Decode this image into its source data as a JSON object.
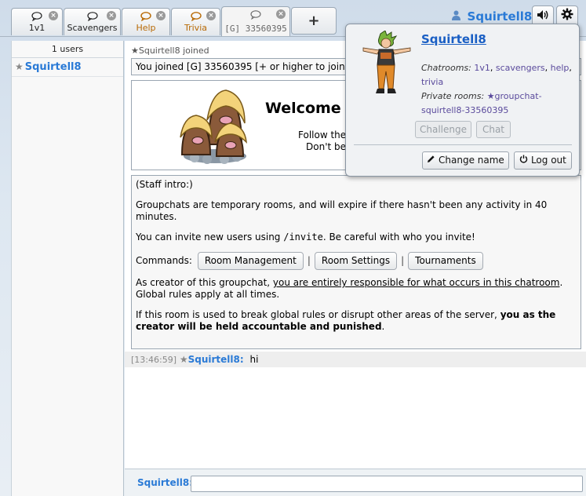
{
  "tabs": [
    {
      "label": "1v1",
      "icon": "chat-bubble-icon"
    },
    {
      "label": "Scavengers",
      "icon": "chat-bubble-icon"
    },
    {
      "label": "Help",
      "icon": "chat-bubble-icon",
      "color": "#b86a05"
    },
    {
      "label": "Trivia",
      "icon": "chat-bubble-icon",
      "color": "#b86a05"
    },
    {
      "label": "[G] 33560395",
      "icon": "chat-bubble-icon",
      "active": true
    }
  ],
  "new_tab_label": "+",
  "header": {
    "username": "Squirtell8"
  },
  "userlist": {
    "count": "1 users",
    "users": [
      {
        "rank": "★",
        "name": "Squirtell8"
      }
    ]
  },
  "chat": {
    "join_notice": "★Squirtell8 joined",
    "joined_text": "You joined [G] 33560395 [+ or higher to join]",
    "welcome_title": "Welcome to",
    "welcome_line1": "Follow the",
    "welcome_line2": "Don't be",
    "intro": {
      "heading": "(Staff intro:)",
      "p1": "Groupchats are temporary rooms, and will expire if there hasn't been any activity in 40 minutes.",
      "p2_a": "You can invite new users using ",
      "p2_code": "/invite",
      "p2_b": ". Be careful with who you invite!",
      "commands_label": "Commands:",
      "commands": [
        "Room Management",
        "Room Settings",
        "Tournaments"
      ],
      "separator": "|",
      "p4_a": "As creator of this groupchat, ",
      "p4_u": "you are entirely responsible for what occurs in this chatroom",
      "p4_b": ". Global rules apply at all times.",
      "p5_a": "If this room is used to break global rules or disrupt other areas of the server, ",
      "p5_b": "you as the creator will be held accountable and punished",
      "p5_c": "."
    },
    "message": {
      "time": "[13:46:59]",
      "rank": "★",
      "user": "Squirtell8:",
      "text": "hi"
    }
  },
  "composer": {
    "username": "Squirtell8:"
  },
  "popup": {
    "name": "Squirtell8",
    "chatrooms_label": "Chatrooms:",
    "chatrooms": [
      "1v1",
      "scavengers",
      "help",
      "trivia"
    ],
    "private_label": "Private rooms:",
    "private_rooms": "★groupchat-squirtell8-33560395",
    "challenge_label": "Challenge",
    "chat_label": "Chat",
    "change_name_label": "Change name",
    "logout_label": "Log out"
  },
  "colors": {
    "accent": "#2a7ad6",
    "orange_tab": "#b86a05"
  }
}
